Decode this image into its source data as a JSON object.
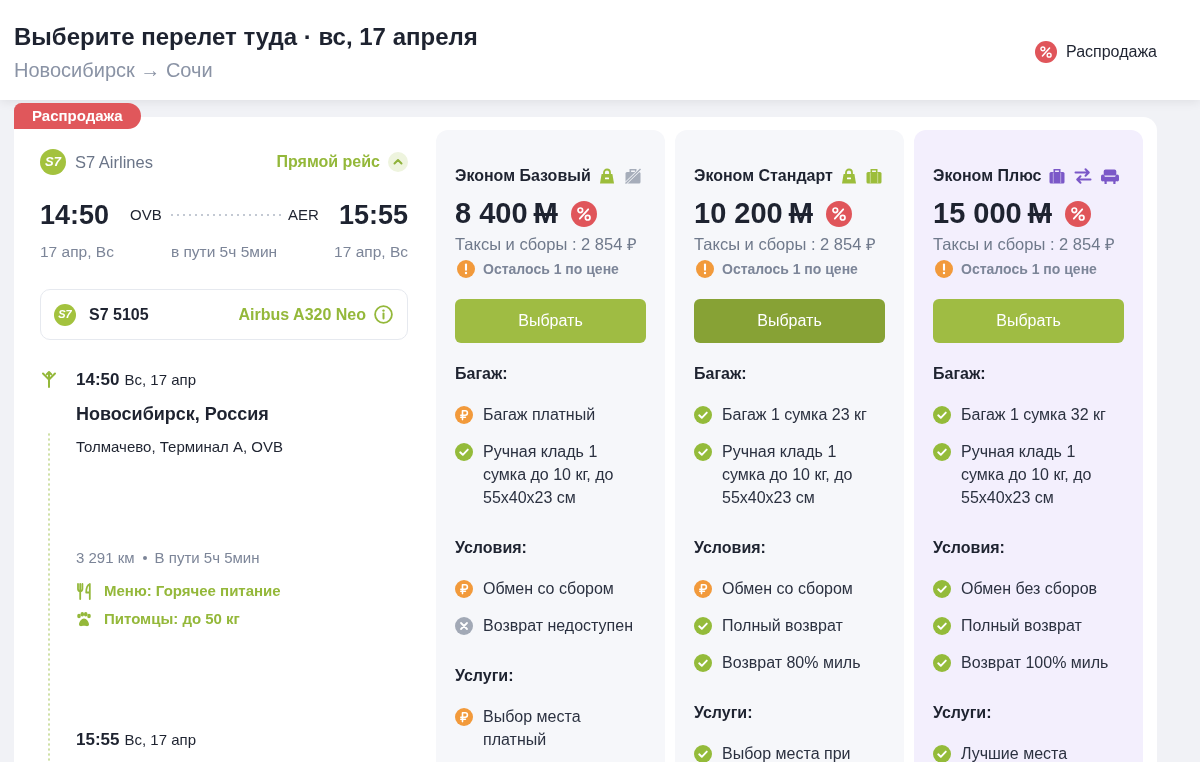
{
  "header": {
    "title": "Выберите перелет туда · вс, 17 апреля",
    "route": "Новосибирск → Сочи",
    "sale_filter": {
      "label": "Распродажа"
    }
  },
  "flight": {
    "badge": "Распродажа",
    "airline": {
      "logo_text": "S7",
      "name": "S7 Airlines"
    },
    "direct": {
      "label": "Прямой рейс",
      "expanded": true
    },
    "departure": {
      "time": "14:50",
      "code": "OVB",
      "date": "17 апр, Вс"
    },
    "duration": "в пути 5ч 5мин",
    "arrival": {
      "time": "15:55",
      "code": "AER",
      "date": "17 апр, Вс"
    },
    "segment": {
      "logo_text": "S7",
      "flight_number": "S7 5105",
      "aircraft": "Airbus A320 Neo"
    },
    "itinerary": {
      "departure": {
        "time": "14:50",
        "date": "Вс, 17 апр",
        "city": "Новосибирск, Россия",
        "airport": "Толмачево, Терминал А, OVB"
      },
      "distance": "3 291 км",
      "travel_time": "В пути 5ч 5мин",
      "amenities": [
        {
          "kind": "meal",
          "text": "Меню: Горячее питание"
        },
        {
          "kind": "pets",
          "text": "Питомцы: до 50 кг"
        }
      ],
      "arrival": {
        "time": "15:55",
        "date": "Вс, 17 апр"
      }
    }
  },
  "fares": [
    {
      "kind": "basic",
      "name": "Эконом Базовый",
      "features": [
        {
          "kind": "handbag"
        },
        {
          "kind": "no-suitcase"
        }
      ],
      "price": "8 400",
      "currency": "M",
      "sale": true,
      "taxes": "Таксы и сборы : 2 854 ₽",
      "availability": "Осталось 1 по цене",
      "button": {
        "label": "Выбрать",
        "selected": false
      },
      "sections": [
        {
          "title": "Багаж:",
          "items": [
            {
              "kind": "paid",
              "text": "Багаж платный"
            },
            {
              "kind": "included",
              "text": "Ручная кладь 1 сумка до 10 кг, до 55x40x23 см"
            }
          ]
        },
        {
          "title": "Условия:",
          "items": [
            {
              "kind": "paid",
              "text": "Обмен со сбором"
            },
            {
              "kind": "unavailable",
              "text": "Возврат недоступен"
            }
          ]
        },
        {
          "title": "Услуги:",
          "items": [
            {
              "kind": "paid",
              "text": "Выбор места платный"
            }
          ]
        }
      ]
    },
    {
      "kind": "basic",
      "name": "Эконом Стандарт",
      "features": [
        {
          "kind": "handbag"
        },
        {
          "kind": "suitcase"
        }
      ],
      "price": "10 200",
      "currency": "M",
      "sale": true,
      "taxes": "Таксы и сборы : 2 854 ₽",
      "availability": "Осталось 1 по цене",
      "button": {
        "label": "Выбрать",
        "selected": true
      },
      "sections": [
        {
          "title": "Багаж:",
          "items": [
            {
              "kind": "included",
              "text": "Багаж 1 сумка 23 кг"
            },
            {
              "kind": "included",
              "text": "Ручная кладь 1 сумка до 10 кг, до 55x40x23 см"
            }
          ]
        },
        {
          "title": "Условия:",
          "items": [
            {
              "kind": "paid",
              "text": "Обмен со сбором"
            },
            {
              "kind": "included",
              "text": "Полный возврат"
            },
            {
              "kind": "included",
              "text": "Возврат 80% миль"
            }
          ]
        },
        {
          "title": "Услуги:",
          "items": [
            {
              "kind": "included",
              "text": "Выбор места при"
            }
          ]
        }
      ]
    },
    {
      "kind": "plus",
      "name": "Эконом Плюс",
      "features": [
        {
          "kind": "suitcase"
        },
        {
          "kind": "exchange"
        },
        {
          "kind": "seat"
        }
      ],
      "price": "15 000",
      "currency": "M",
      "sale": true,
      "taxes": "Таксы и сборы : 2 854 ₽",
      "availability": "Осталось 1 по цене",
      "button": {
        "label": "Выбрать",
        "selected": false
      },
      "sections": [
        {
          "title": "Багаж:",
          "items": [
            {
              "kind": "included",
              "text": "Багаж 1 сумка 32 кг"
            },
            {
              "kind": "included",
              "text": "Ручная кладь 1 сумка до 10 кг, до 55x40x23 см"
            }
          ]
        },
        {
          "title": "Условия:",
          "items": [
            {
              "kind": "included",
              "text": "Обмен без сборов"
            },
            {
              "kind": "included",
              "text": "Полный возврат"
            },
            {
              "kind": "included",
              "text": "Возврат 100% миль"
            }
          ]
        },
        {
          "title": "Услуги:",
          "items": [
            {
              "kind": "included",
              "text": "Лучшие места"
            }
          ]
        }
      ]
    }
  ]
}
